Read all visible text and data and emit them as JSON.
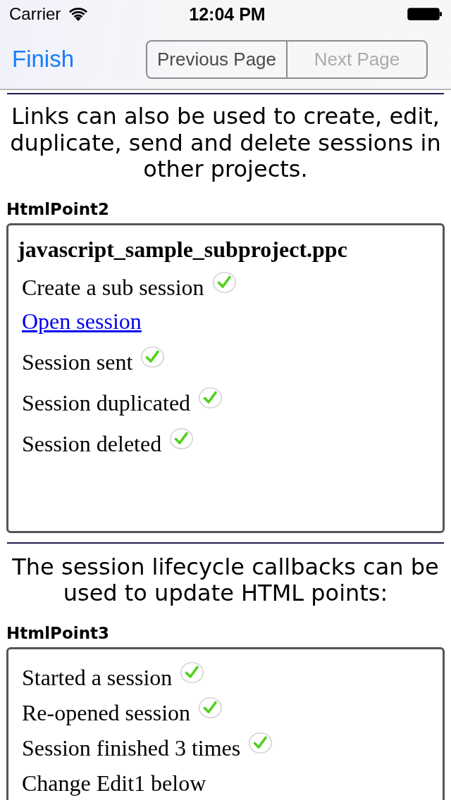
{
  "status_bar": {
    "carrier": "Carrier",
    "time": "12:04 PM"
  },
  "nav_bar": {
    "finish_button": "Finish",
    "page_buttons": [
      {
        "label": "Previous Page",
        "disabled": false
      },
      {
        "label": "Next Page",
        "disabled": true
      }
    ]
  },
  "sections": [
    {
      "intro": "Links can also be used to create, edit, duplicate, send and delete sessions in other projects.",
      "point_label": "HtmlPoint2",
      "heading": "javascript_sample_subproject.ppc",
      "items": [
        {
          "kind": "status",
          "text": "Create a sub session",
          "checked": true
        },
        {
          "kind": "link",
          "text": "Open session"
        },
        {
          "kind": "status",
          "text": "Session sent",
          "checked": true
        },
        {
          "kind": "status",
          "text": "Session duplicated",
          "checked": true
        },
        {
          "kind": "status",
          "text": "Session deleted",
          "checked": true
        }
      ]
    },
    {
      "intro": "The session lifecycle callbacks can be used to update HTML points:",
      "point_label": "HtmlPoint3",
      "items": [
        {
          "kind": "status",
          "text": "Started a session",
          "checked": true
        },
        {
          "kind": "status",
          "text": "Re-opened session",
          "checked": true
        },
        {
          "kind": "status",
          "text": "Session finished 3 times",
          "checked": true
        },
        {
          "kind": "status",
          "text": "Change Edit1 below",
          "checked": false
        }
      ]
    }
  ]
}
